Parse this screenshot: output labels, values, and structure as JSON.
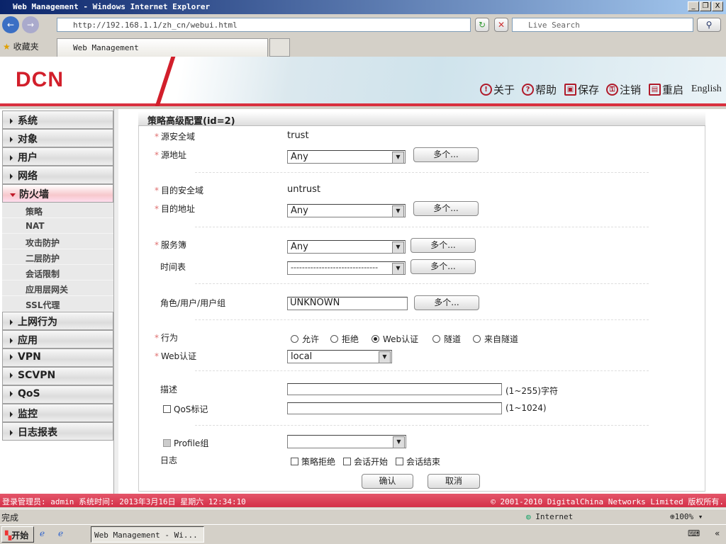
{
  "window": {
    "title": "Web Management - Windows Internet Explorer",
    "controls": [
      "_",
      "❐",
      "X"
    ]
  },
  "browser": {
    "url": "http://192.168.1.1/zh_cn/webui.html",
    "search_placeholder": "Live Search",
    "favorites": "收藏夹",
    "tab": "Web Management"
  },
  "header": {
    "logo": "DCN",
    "links": [
      {
        "label": "关于",
        "icon": "!"
      },
      {
        "label": "帮助",
        "icon": "?"
      },
      {
        "label": "保存",
        "icon": "▣"
      },
      {
        "label": "注销",
        "icon": "⚿"
      },
      {
        "label": "重启",
        "icon": "▤"
      }
    ],
    "english": "English"
  },
  "sidebar": {
    "top": [
      "系统",
      "对象",
      "用户",
      "网络"
    ],
    "active": "防火墙",
    "subitems": [
      "策略",
      "NAT",
      "攻击防护",
      "二层防护",
      "会话限制",
      "应用层网关",
      "SSL代理"
    ],
    "bottom": [
      "上网行为",
      "应用",
      "VPN",
      "SCVPN",
      "QoS",
      "监控",
      "日志报表"
    ]
  },
  "form": {
    "title": "策略高级配置(id=2)",
    "src_zone_label": "源安全域",
    "src_zone": "trust",
    "src_addr_label": "源地址",
    "src_addr": "Any",
    "dst_zone_label": "目的安全域",
    "dst_zone": "untrust",
    "dst_addr_label": "目的地址",
    "dst_addr": "Any",
    "service_label": "服务簿",
    "service": "Any",
    "schedule_label": "时间表",
    "schedule": "-------------------------------",
    "role_label": "角色/用户/用户组",
    "role": "UNKNOWN",
    "multi": "多个...",
    "action_label": "行为",
    "actions": [
      "允许",
      "拒绝",
      "Web认证",
      "隧道",
      "来自隧道"
    ],
    "action_selected": "Web认证",
    "webauth_label": "Web认证",
    "webauth": "local",
    "desc_label": "描述",
    "desc_hint": "(1~255)字符",
    "qos_label": "QoS标记",
    "qos_hint": "(1~1024)",
    "profile_label": "Profile组",
    "log_label": "日志",
    "log_options": [
      "策略拒绝",
      "会话开始",
      "会话结束"
    ],
    "ok": "确认",
    "cancel": "取消"
  },
  "footer": {
    "left": "登录管理员: admin 系统时间: 2013年3月16日 星期六 12:34:10",
    "right": "© 2001-2010 DigitalChina Networks Limited 版权所有."
  },
  "statusbar": {
    "text": "完成",
    "zone": "Internet",
    "zoom": "100%"
  },
  "taskbar": {
    "start": "开始",
    "task": "Web Management - Wi..."
  }
}
